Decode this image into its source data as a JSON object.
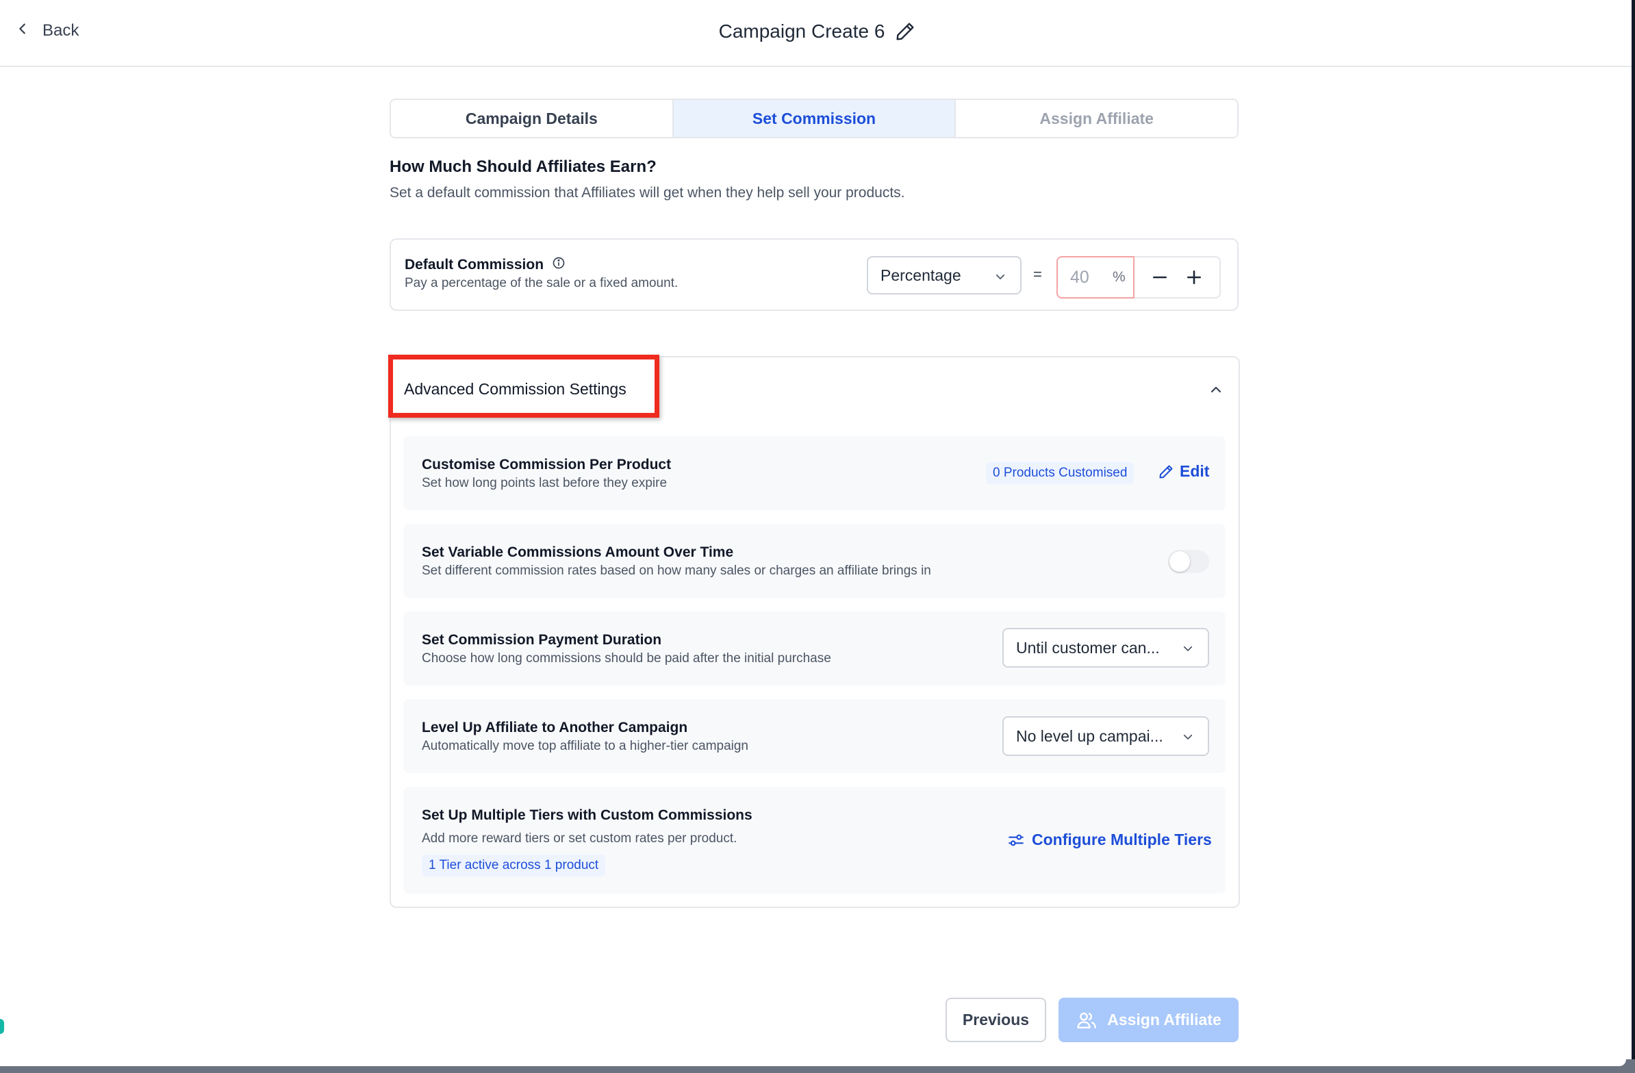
{
  "header": {
    "back_label": "Back",
    "title": "Campaign Create 6"
  },
  "steps": [
    {
      "label": "Campaign Details",
      "state": "done"
    },
    {
      "label": "Set Commission",
      "state": "active"
    },
    {
      "label": "Assign Affiliate",
      "state": "disabled"
    }
  ],
  "section": {
    "title": "How Much Should Affiliates Earn?",
    "subtitle": "Set a default commission that Affiliates will get when they help sell your products."
  },
  "default_commission": {
    "title": "Default Commission",
    "subtitle": "Pay a percentage of the sale or a fixed amount.",
    "type_value": "Percentage",
    "equals": "=",
    "amount_placeholder": "40",
    "unit": "%"
  },
  "advanced": {
    "title": "Advanced Commission Settings",
    "expanded": true,
    "rows": {
      "per_product": {
        "title": "Customise Commission Per Product",
        "subtitle": "Set how long points last before they expire",
        "badge": "0 Products Customised",
        "action": "Edit"
      },
      "variable": {
        "title": "Set Variable Commissions Amount Over Time",
        "subtitle": "Set different commission rates based on how many sales or charges an affiliate brings in",
        "enabled": false
      },
      "duration": {
        "title": "Set Commission Payment Duration",
        "subtitle": "Choose how long commissions should be paid after the initial purchase",
        "value": "Until customer can..."
      },
      "level_up": {
        "title": "Level Up Affiliate to Another Campaign",
        "subtitle": "Automatically move top affiliate to a higher-tier campaign",
        "value": "No level up campai..."
      },
      "tiers": {
        "title": "Set Up Multiple Tiers with Custom Commissions",
        "subtitle": "Add more reward tiers or set custom rates per product.",
        "badge": "1 Tier active across 1 product",
        "action": "Configure Multiple Tiers"
      }
    }
  },
  "footer": {
    "previous_label": "Previous",
    "next_label": "Assign Affiliate"
  },
  "colors": {
    "accent": "#1d4ed8",
    "highlight": "#ef2b1f",
    "next_disabled": "#a9c8fb"
  }
}
